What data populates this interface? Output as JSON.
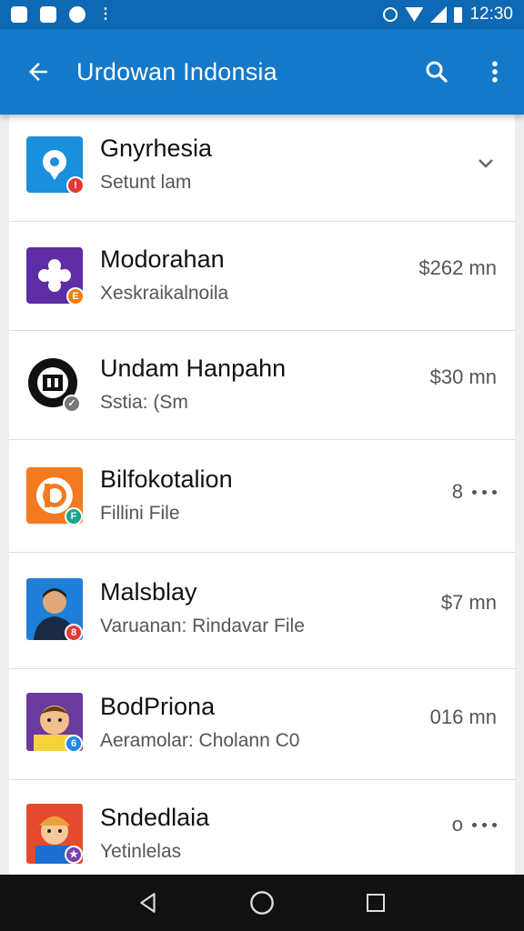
{
  "status_bar": {
    "time": "12:30",
    "icons": [
      "upload-icon",
      "image-icon",
      "sync-icon",
      "more-dots-icon",
      "alarm-icon",
      "wifi-icon",
      "signal-icon",
      "battery-icon"
    ]
  },
  "app_bar": {
    "title": "Urdowan Indonsia",
    "back_icon": "arrow-back-icon",
    "search_icon": "search-icon",
    "menu_icon": "overflow-menu-icon",
    "color": "#1479c9"
  },
  "items": [
    {
      "name": "Gnyrhesia",
      "subtitle": "Setunt lam",
      "meta": "",
      "trailing": "chevron-down-icon",
      "avatar_color": "#1a8fdc",
      "badge_color": "#e53935"
    },
    {
      "name": "Modorahan",
      "subtitle": "Xeskraikalnoila",
      "meta": "$262 mn",
      "trailing": "",
      "avatar_color": "#5e2ca5",
      "badge_color": "#f57c00"
    },
    {
      "name": "Undam Hanpahn",
      "subtitle": "Sstia: (Sm",
      "meta": "$30 mn",
      "trailing": "",
      "avatar_color": "#111111",
      "badge_color": "#777777"
    },
    {
      "name": "Bilfokotalion",
      "subtitle": "Fillini File",
      "meta": "8",
      "trailing": "more-horizontal-icon",
      "avatar_color": "#f47a20",
      "badge_color": "#1aa68a"
    },
    {
      "name": "Malsblay",
      "subtitle": "Varuanan: Rindavar File",
      "meta": "$7 mn",
      "trailing": "",
      "avatar_color": "#1f7fd8",
      "badge_color": "#e53935"
    },
    {
      "name": "BodPriona",
      "subtitle": "Aeramolar: Cholann C0",
      "meta": "016 mn",
      "trailing": "",
      "avatar_color": "#6a3a9c",
      "badge_color": "#1e88e5"
    },
    {
      "name": "Sndedlaia",
      "subtitle": "Yetinlelas",
      "meta": "o",
      "trailing": "more-horizontal-icon",
      "avatar_color": "#e54a2e",
      "badge_color": "#7b3fb0"
    }
  ],
  "nav_bar": {
    "icons": [
      "back-triangle-icon",
      "home-circle-icon",
      "recents-square-icon"
    ]
  }
}
